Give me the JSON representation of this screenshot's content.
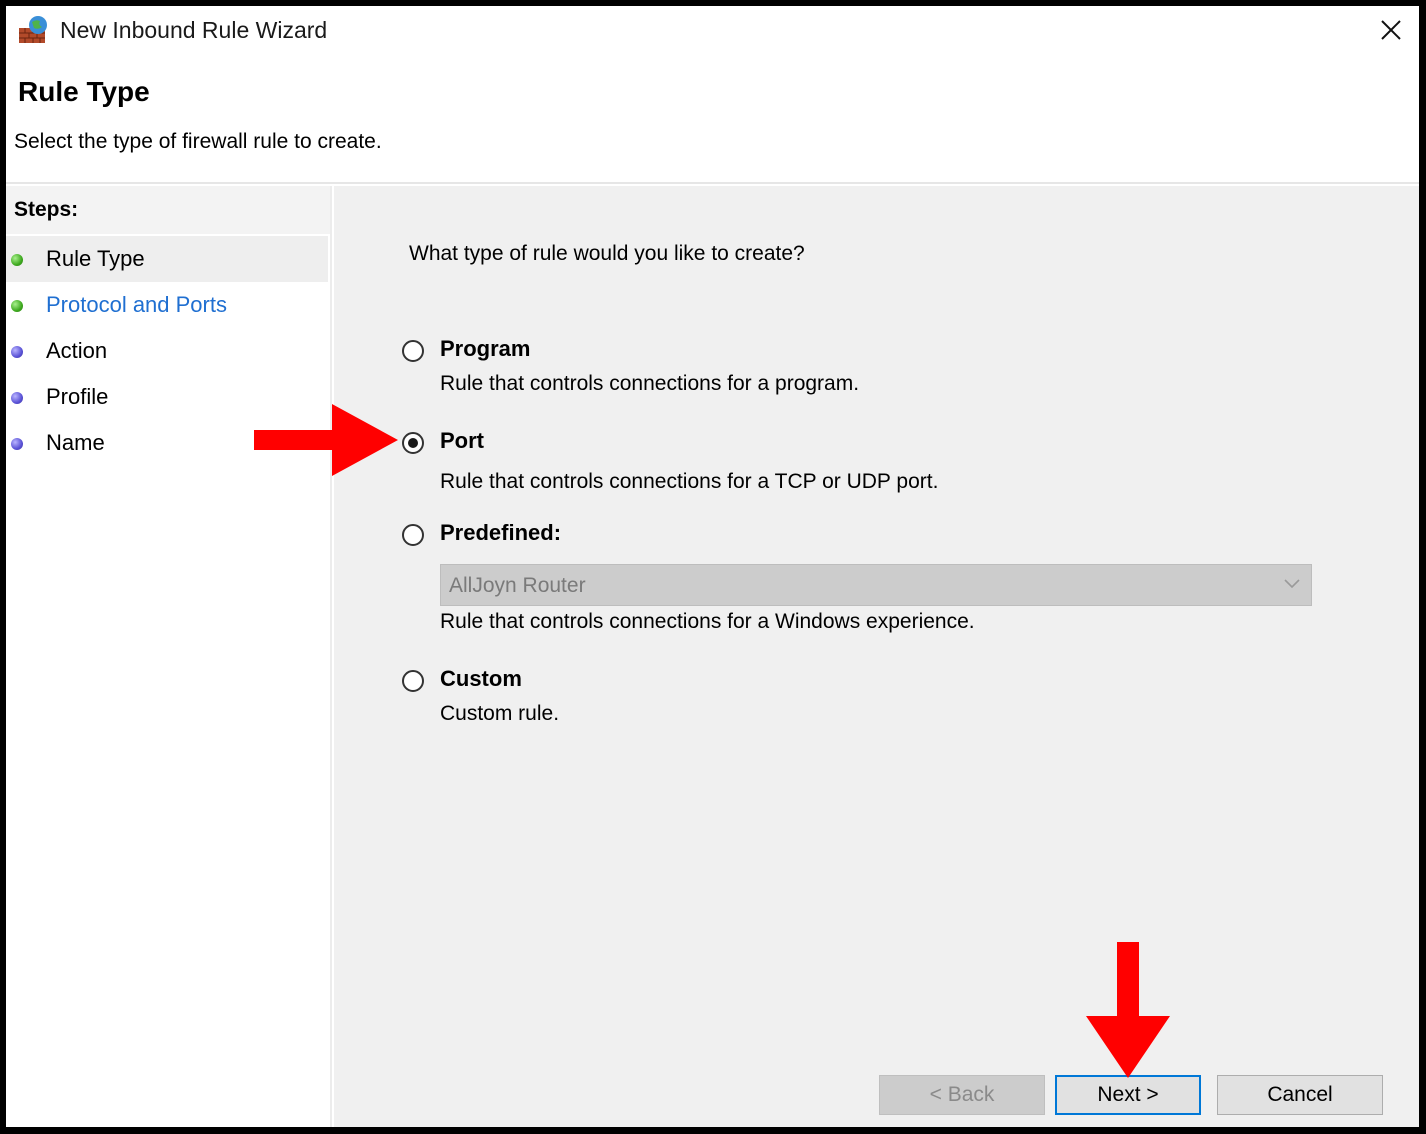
{
  "window": {
    "title": "New Inbound Rule Wizard",
    "icon": "firewall-globe-icon"
  },
  "header": {
    "title": "Rule Type",
    "subtitle": "Select the type of firewall rule to create."
  },
  "steps": {
    "title": "Steps:",
    "items": [
      {
        "label": "Rule Type",
        "status": "current"
      },
      {
        "label": "Protocol and Ports",
        "status": "link"
      },
      {
        "label": "Action",
        "status": "pending"
      },
      {
        "label": "Profile",
        "status": "pending"
      },
      {
        "label": "Name",
        "status": "pending"
      }
    ]
  },
  "main": {
    "question": "What type of rule would you like to create?",
    "options": [
      {
        "label": "Program",
        "description": "Rule that controls connections for a program.",
        "selected": false
      },
      {
        "label": "Port",
        "description": "Rule that controls connections for a TCP or UDP port.",
        "selected": true
      },
      {
        "label": "Predefined:",
        "description": "Rule that controls connections for a Windows experience.",
        "selected": false
      },
      {
        "label": "Custom",
        "description": "Custom rule.",
        "selected": false
      }
    ],
    "predefined_select": {
      "value": "AllJoyn Router",
      "disabled": true
    }
  },
  "buttons": {
    "back": "< Back",
    "next": "Next >",
    "cancel": "Cancel"
  },
  "colors": {
    "annotation_arrow": "#ff0000",
    "link": "#1f6fd1",
    "focus_border": "#0078d7"
  }
}
